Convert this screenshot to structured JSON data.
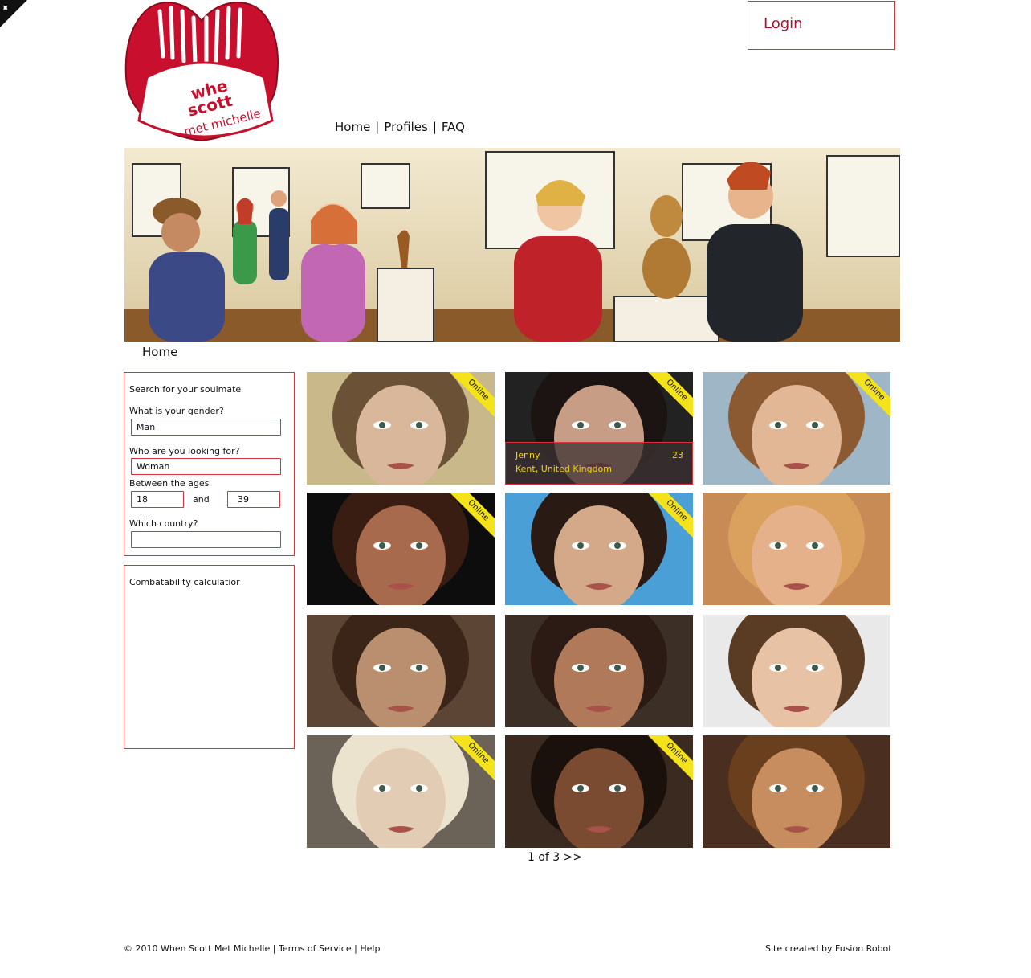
{
  "logo": {
    "line1": "whe",
    "line2": "scott",
    "line3": "met michelle"
  },
  "header": {
    "login_label": "Login"
  },
  "nav": {
    "items": [
      "Home",
      "Profiles",
      "FAQ"
    ],
    "separator": "|"
  },
  "breadcrumb": "Home",
  "search": {
    "title": "Search for your soulmate",
    "gender_label": "What is your gender?",
    "gender_value": "Man",
    "looking_label": "Who are you looking for?",
    "looking_value": "Woman",
    "ages_label": "Between the ages",
    "age_min": "18",
    "and_label": "and",
    "age_max": "39",
    "country_label": "Which country?",
    "country_value": ""
  },
  "compat": {
    "title": "Combatability calculatior"
  },
  "online_label": "Online",
  "profiles": [
    {
      "online": true,
      "skin": "#d9b79a",
      "hair": "#6b5237",
      "bg": "#c9b98a"
    },
    {
      "online": true,
      "skin": "#c79d86",
      "hair": "#1c1412",
      "bg": "#222222",
      "name": "Jenny",
      "age": "23",
      "location": "Kent, United Kingdom"
    },
    {
      "online": true,
      "skin": "#e2b796",
      "hair": "#8b5a33",
      "bg": "#9fb6c6"
    },
    {
      "online": true,
      "skin": "#a86a4c",
      "hair": "#3a1d12",
      "bg": "#0e0d0d"
    },
    {
      "online": true,
      "skin": "#d3a98a",
      "hair": "#2a1a14",
      "bg": "#4aa0d6"
    },
    {
      "online": false,
      "skin": "#e5b18a",
      "hair": "#d9a05e",
      "bg": "#c98b55"
    },
    {
      "online": false,
      "skin": "#b98f6f",
      "hair": "#3a2518",
      "bg": "#5d4535"
    },
    {
      "online": false,
      "skin": "#b07a5a",
      "hair": "#2b1b14",
      "bg": "#3c3026"
    },
    {
      "online": false,
      "skin": "#e7c2a4",
      "hair": "#5a3b24",
      "bg": "#e9e9e9"
    },
    {
      "online": true,
      "skin": "#e3ccb4",
      "hair": "#ece3cf",
      "bg": "#6b6258"
    },
    {
      "online": true,
      "skin": "#7a4a31",
      "hair": "#1a100c",
      "bg": "#3a2a20"
    },
    {
      "online": false,
      "skin": "#c88d5f",
      "hair": "#6a3f1d",
      "bg": "#4a2e1f"
    }
  ],
  "pagination": {
    "current": "1 of 3",
    "next": ">>"
  },
  "footer": {
    "copyright": "© 2010 When Scott Met Michelle",
    "separator": "|",
    "links": [
      "Terms of Service",
      "Help"
    ],
    "credit": "Site created by Fusion Robot"
  },
  "colors": {
    "accent": "#d9323b",
    "brand": "#c8102e",
    "ribbon": "#f4e31a"
  }
}
